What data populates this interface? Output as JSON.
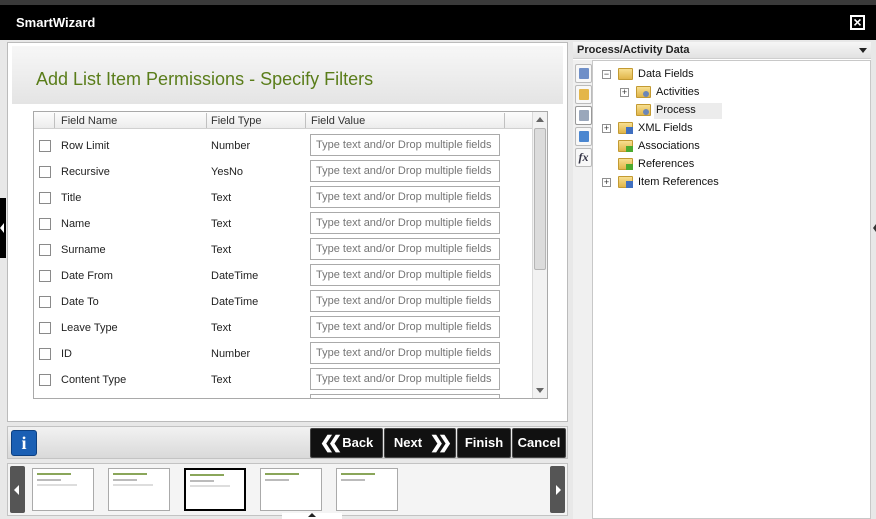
{
  "window": {
    "title": "SmartWizard",
    "close_icon": "close-icon"
  },
  "page": {
    "title": "Add List Item Permissions - Specify Filters"
  },
  "grid": {
    "columns": [
      "Field Name",
      "Field Type",
      "Field Value"
    ],
    "placeholder": "Type text and/or Drop multiple fields",
    "rows": [
      {
        "name": "Row Limit",
        "type": "Number"
      },
      {
        "name": "Recursive",
        "type": "YesNo"
      },
      {
        "name": "Title",
        "type": "Text"
      },
      {
        "name": "Name",
        "type": "Text"
      },
      {
        "name": "Surname",
        "type": "Text"
      },
      {
        "name": "Date From",
        "type": "DateTime"
      },
      {
        "name": "Date To",
        "type": "DateTime"
      },
      {
        "name": "Leave Type",
        "type": "Text"
      },
      {
        "name": "ID",
        "type": "Number"
      },
      {
        "name": "Content Type",
        "type": "Text"
      }
    ]
  },
  "toolbar": {
    "info_label": "i",
    "back_label": "Back",
    "next_label": "Next",
    "finish_label": "Finish",
    "cancel_label": "Cancel"
  },
  "side_panel": {
    "title": "Process/Activity Data",
    "tree": [
      {
        "label": "Data Fields",
        "expander": "−",
        "icon": "folder-icon"
      },
      {
        "label": "Activities",
        "expander": "+",
        "icon": "activity-folder-icon"
      },
      {
        "label": "Process",
        "expander": "",
        "icon": "process-folder-icon",
        "selected": true
      },
      {
        "label": "XML Fields",
        "expander": "+",
        "icon": "xml-folder-icon"
      },
      {
        "label": "Associations",
        "expander": "",
        "icon": "associations-folder-icon"
      },
      {
        "label": "References",
        "expander": "",
        "icon": "references-folder-icon"
      },
      {
        "label": "Item References",
        "expander": "+",
        "icon": "item-references-folder-icon"
      }
    ],
    "tabs": [
      "process-data-tab-icon",
      "environment-tab-icon",
      "object-browser-tab-icon",
      "variables-tab-icon",
      "functions-tab-icon"
    ],
    "functions_tab_label": "fx"
  },
  "colors": {
    "title_green": "#5a7d1a",
    "info_blue": "#1a5fb4",
    "titlebar": "#000000"
  }
}
